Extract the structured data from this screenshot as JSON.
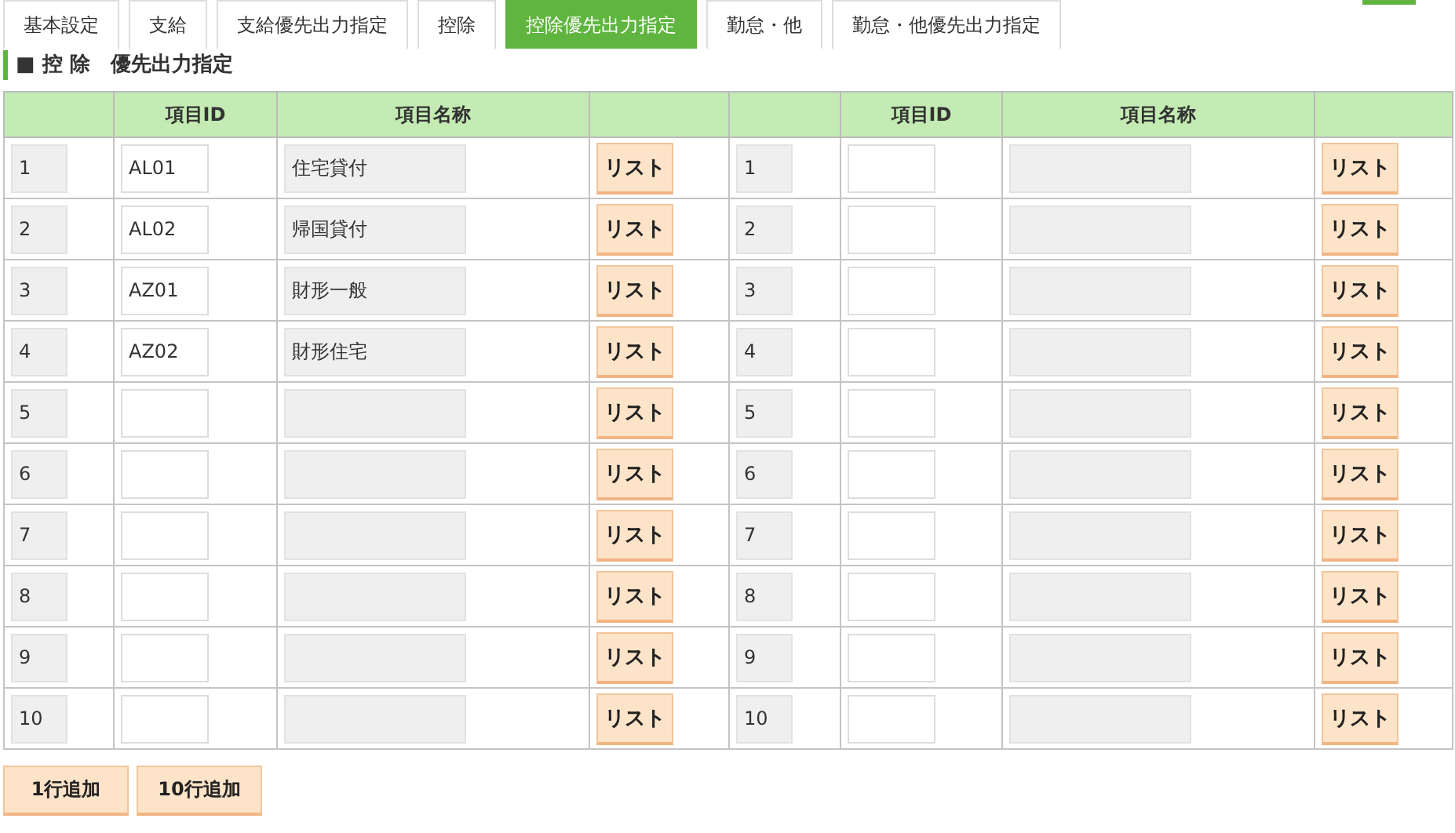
{
  "tabs": [
    {
      "label": "基本設定",
      "selected": false
    },
    {
      "label": "支給",
      "selected": false
    },
    {
      "label": "支給優先出力指定",
      "selected": false
    },
    {
      "label": "控除",
      "selected": false
    },
    {
      "label": "控除優先出力指定",
      "selected": true
    },
    {
      "label": "勤怠・他",
      "selected": false
    },
    {
      "label": "勤怠・他優先出力指定",
      "selected": false
    }
  ],
  "section_title": "■ 控 除　優先出力指定",
  "table": {
    "headers": [
      "項目ID",
      "項目名称",
      "項目ID",
      "項目名称"
    ],
    "rows": [
      {
        "left": {
          "no": "1",
          "id": "AL01",
          "name": "住宅貸付",
          "button": "リスト"
        },
        "right": {
          "no": "1",
          "button": "リスト"
        }
      },
      {
        "left": {
          "no": "2",
          "id": "AL02",
          "name": "帰国貸付",
          "button": "リスト"
        },
        "right": {
          "no": "2",
          "button": "リスト"
        }
      },
      {
        "left": {
          "no": "3",
          "id": "AZ01",
          "name": "財形一般",
          "button": "リスト"
        },
        "right": {
          "no": "3",
          "button": "リスト"
        }
      },
      {
        "left": {
          "no": "4",
          "id": "AZ02",
          "name": "財形住宅",
          "button": "リスト"
        },
        "right": {
          "no": "4",
          "button": "リスト"
        }
      },
      {
        "left": {
          "no": "5",
          "button": "リスト"
        },
        "right": {
          "no": "5",
          "button": "リスト"
        }
      },
      {
        "left": {
          "no": "6",
          "button": "リスト"
        },
        "right": {
          "no": "6",
          "button": "リスト"
        }
      },
      {
        "left": {
          "no": "7",
          "button": "リスト"
        },
        "right": {
          "no": "7",
          "button": "リスト"
        }
      },
      {
        "left": {
          "no": "8",
          "button": "リスト"
        },
        "right": {
          "no": "8",
          "button": "リスト"
        }
      },
      {
        "left": {
          "no": "9",
          "button": "リスト"
        },
        "right": {
          "no": "9",
          "button": "リスト"
        }
      },
      {
        "left": {
          "no": "10",
          "button": "リスト"
        },
        "right": {
          "no": "10",
          "button": "リスト"
        }
      }
    ]
  },
  "add_buttons": [
    "1行追加",
    "10行追加"
  ]
}
